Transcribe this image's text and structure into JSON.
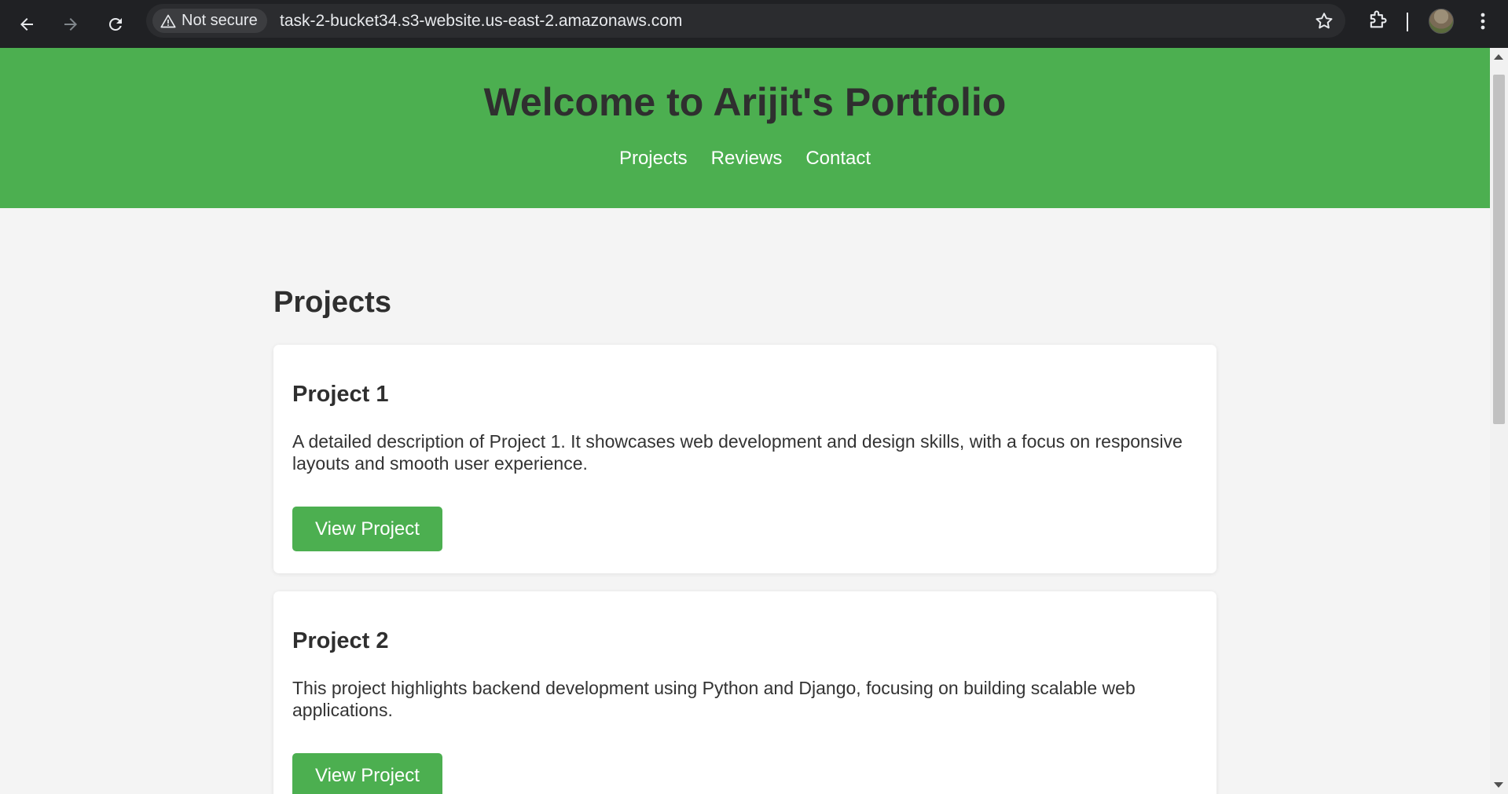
{
  "browser": {
    "security_label": "Not secure",
    "url": "task-2-bucket34.s3-website.us-east-2.amazonaws.com",
    "icons": [
      "back-arrow-icon",
      "forward-arrow-icon",
      "reload-icon",
      "warning-icon",
      "star-icon",
      "extensions-icon",
      "avatar",
      "more-menu-icon"
    ]
  },
  "header": {
    "title": "Welcome to Arijit's Portfolio",
    "nav": [
      "Projects",
      "Reviews",
      "Contact"
    ]
  },
  "projects": {
    "heading": "Projects",
    "items": [
      {
        "title": "Project 1",
        "description": "A detailed description of Project 1. It showcases web development and design skills, with a focus on responsive layouts and smooth user experience.",
        "button": "View Project"
      },
      {
        "title": "Project 2",
        "description": "This project highlights backend development using Python and Django, focusing on building scalable web applications.",
        "button": "View Project"
      }
    ]
  },
  "colors": {
    "accent": "#4caf50",
    "page_background": "#f4f4f4",
    "chrome_background": "#202124"
  }
}
